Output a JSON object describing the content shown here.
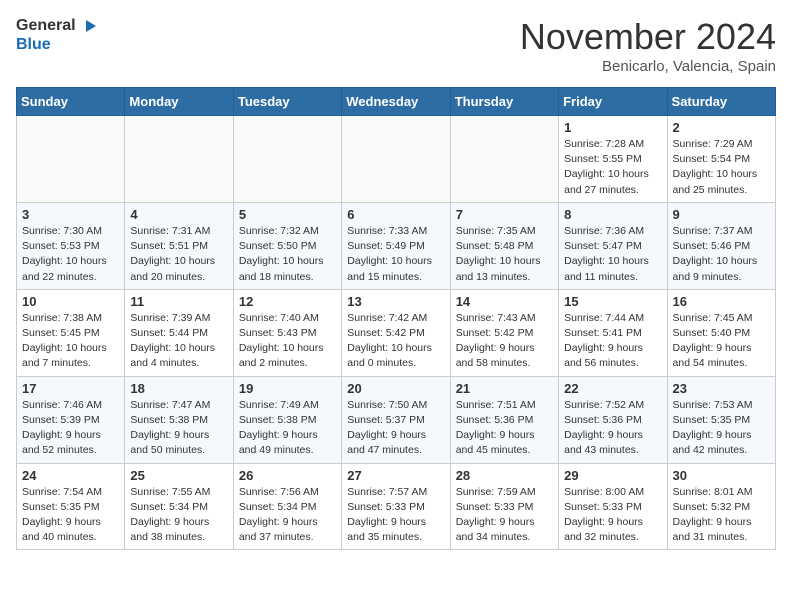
{
  "header": {
    "logo_general": "General",
    "logo_blue": "Blue",
    "month_title": "November 2024",
    "location": "Benicarlo, Valencia, Spain"
  },
  "weekdays": [
    "Sunday",
    "Monday",
    "Tuesday",
    "Wednesday",
    "Thursday",
    "Friday",
    "Saturday"
  ],
  "weeks": [
    [
      {
        "day": "",
        "info": ""
      },
      {
        "day": "",
        "info": ""
      },
      {
        "day": "",
        "info": ""
      },
      {
        "day": "",
        "info": ""
      },
      {
        "day": "",
        "info": ""
      },
      {
        "day": "1",
        "info": "Sunrise: 7:28 AM\nSunset: 5:55 PM\nDaylight: 10 hours and 27 minutes."
      },
      {
        "day": "2",
        "info": "Sunrise: 7:29 AM\nSunset: 5:54 PM\nDaylight: 10 hours and 25 minutes."
      }
    ],
    [
      {
        "day": "3",
        "info": "Sunrise: 7:30 AM\nSunset: 5:53 PM\nDaylight: 10 hours and 22 minutes."
      },
      {
        "day": "4",
        "info": "Sunrise: 7:31 AM\nSunset: 5:51 PM\nDaylight: 10 hours and 20 minutes."
      },
      {
        "day": "5",
        "info": "Sunrise: 7:32 AM\nSunset: 5:50 PM\nDaylight: 10 hours and 18 minutes."
      },
      {
        "day": "6",
        "info": "Sunrise: 7:33 AM\nSunset: 5:49 PM\nDaylight: 10 hours and 15 minutes."
      },
      {
        "day": "7",
        "info": "Sunrise: 7:35 AM\nSunset: 5:48 PM\nDaylight: 10 hours and 13 minutes."
      },
      {
        "day": "8",
        "info": "Sunrise: 7:36 AM\nSunset: 5:47 PM\nDaylight: 10 hours and 11 minutes."
      },
      {
        "day": "9",
        "info": "Sunrise: 7:37 AM\nSunset: 5:46 PM\nDaylight: 10 hours and 9 minutes."
      }
    ],
    [
      {
        "day": "10",
        "info": "Sunrise: 7:38 AM\nSunset: 5:45 PM\nDaylight: 10 hours and 7 minutes."
      },
      {
        "day": "11",
        "info": "Sunrise: 7:39 AM\nSunset: 5:44 PM\nDaylight: 10 hours and 4 minutes."
      },
      {
        "day": "12",
        "info": "Sunrise: 7:40 AM\nSunset: 5:43 PM\nDaylight: 10 hours and 2 minutes."
      },
      {
        "day": "13",
        "info": "Sunrise: 7:42 AM\nSunset: 5:42 PM\nDaylight: 10 hours and 0 minutes."
      },
      {
        "day": "14",
        "info": "Sunrise: 7:43 AM\nSunset: 5:42 PM\nDaylight: 9 hours and 58 minutes."
      },
      {
        "day": "15",
        "info": "Sunrise: 7:44 AM\nSunset: 5:41 PM\nDaylight: 9 hours and 56 minutes."
      },
      {
        "day": "16",
        "info": "Sunrise: 7:45 AM\nSunset: 5:40 PM\nDaylight: 9 hours and 54 minutes."
      }
    ],
    [
      {
        "day": "17",
        "info": "Sunrise: 7:46 AM\nSunset: 5:39 PM\nDaylight: 9 hours and 52 minutes."
      },
      {
        "day": "18",
        "info": "Sunrise: 7:47 AM\nSunset: 5:38 PM\nDaylight: 9 hours and 50 minutes."
      },
      {
        "day": "19",
        "info": "Sunrise: 7:49 AM\nSunset: 5:38 PM\nDaylight: 9 hours and 49 minutes."
      },
      {
        "day": "20",
        "info": "Sunrise: 7:50 AM\nSunset: 5:37 PM\nDaylight: 9 hours and 47 minutes."
      },
      {
        "day": "21",
        "info": "Sunrise: 7:51 AM\nSunset: 5:36 PM\nDaylight: 9 hours and 45 minutes."
      },
      {
        "day": "22",
        "info": "Sunrise: 7:52 AM\nSunset: 5:36 PM\nDaylight: 9 hours and 43 minutes."
      },
      {
        "day": "23",
        "info": "Sunrise: 7:53 AM\nSunset: 5:35 PM\nDaylight: 9 hours and 42 minutes."
      }
    ],
    [
      {
        "day": "24",
        "info": "Sunrise: 7:54 AM\nSunset: 5:35 PM\nDaylight: 9 hours and 40 minutes."
      },
      {
        "day": "25",
        "info": "Sunrise: 7:55 AM\nSunset: 5:34 PM\nDaylight: 9 hours and 38 minutes."
      },
      {
        "day": "26",
        "info": "Sunrise: 7:56 AM\nSunset: 5:34 PM\nDaylight: 9 hours and 37 minutes."
      },
      {
        "day": "27",
        "info": "Sunrise: 7:57 AM\nSunset: 5:33 PM\nDaylight: 9 hours and 35 minutes."
      },
      {
        "day": "28",
        "info": "Sunrise: 7:59 AM\nSunset: 5:33 PM\nDaylight: 9 hours and 34 minutes."
      },
      {
        "day": "29",
        "info": "Sunrise: 8:00 AM\nSunset: 5:33 PM\nDaylight: 9 hours and 32 minutes."
      },
      {
        "day": "30",
        "info": "Sunrise: 8:01 AM\nSunset: 5:32 PM\nDaylight: 9 hours and 31 minutes."
      }
    ]
  ]
}
